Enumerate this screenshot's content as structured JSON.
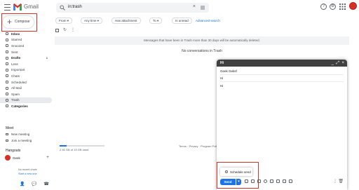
{
  "app": {
    "brand": "Gmail",
    "brand_color": "#d93025"
  },
  "search": {
    "query": "in:trash"
  },
  "topbar_icons": [
    "help-icon",
    "settings-icon",
    "apps-icon"
  ],
  "compose_button": {
    "label": "Compose"
  },
  "sidebar": {
    "items": [
      {
        "label": "Inbox",
        "icon": "inbox-icon",
        "bold": true,
        "count": ""
      },
      {
        "label": "Starred",
        "icon": "star-icon",
        "bold": false,
        "count": ""
      },
      {
        "label": "Snoozed",
        "icon": "clock-icon",
        "bold": false,
        "count": ""
      },
      {
        "label": "Sent",
        "icon": "send-icon",
        "bold": false,
        "count": ""
      },
      {
        "label": "Drafts",
        "icon": "draft-icon",
        "bold": true,
        "count": "1"
      },
      {
        "label": "Less",
        "icon": "chevron-up-icon",
        "bold": false,
        "count": ""
      },
      {
        "label": "Important",
        "icon": "important-icon",
        "bold": false,
        "count": ""
      },
      {
        "label": "Chats",
        "icon": "chat-icon",
        "bold": false,
        "count": ""
      },
      {
        "label": "Scheduled",
        "icon": "scheduled-icon",
        "bold": false,
        "count": ""
      },
      {
        "label": "All Mail",
        "icon": "mail-icon",
        "bold": false,
        "count": ""
      },
      {
        "label": "Spam",
        "icon": "spam-icon",
        "bold": false,
        "count": ""
      },
      {
        "label": "Trash",
        "icon": "trash-icon",
        "bold": false,
        "count": "",
        "active": true
      },
      {
        "label": "Categories",
        "icon": "label-icon",
        "bold": true,
        "count": ""
      }
    ],
    "meet_title": "Meet",
    "meet_items": [
      {
        "label": "New meeting",
        "icon": "video-icon"
      },
      {
        "label": "Join a meeting",
        "icon": "keyboard-icon"
      }
    ],
    "hangouts_title": "Hangouts",
    "hangouts_user": "Geek",
    "hangouts_empty_line1": "No recent chats",
    "hangouts_empty_line2": "Start a new one"
  },
  "filters": {
    "chips": [
      "From",
      "Any time",
      "Has attachment",
      "To",
      "Is unread"
    ],
    "advanced": "Advanced search"
  },
  "main": {
    "trash_notice": "Messages that have been in Trash more than 30 days will be automatically deleted.",
    "empty_message": "No conversations in Trash",
    "storage_text": "2.46 GB of 15 GB used",
    "storage_fraction": 0.16,
    "footer": "Terms · Privacy · Program Policies"
  },
  "compose_window": {
    "title": "Hi",
    "to": "Geek Geksf",
    "subject": "Hi",
    "body": "Hi",
    "schedule_send": "Schedule send",
    "send_label": "Send",
    "header_bg": "#404040",
    "send_color": "#1a73e8"
  }
}
